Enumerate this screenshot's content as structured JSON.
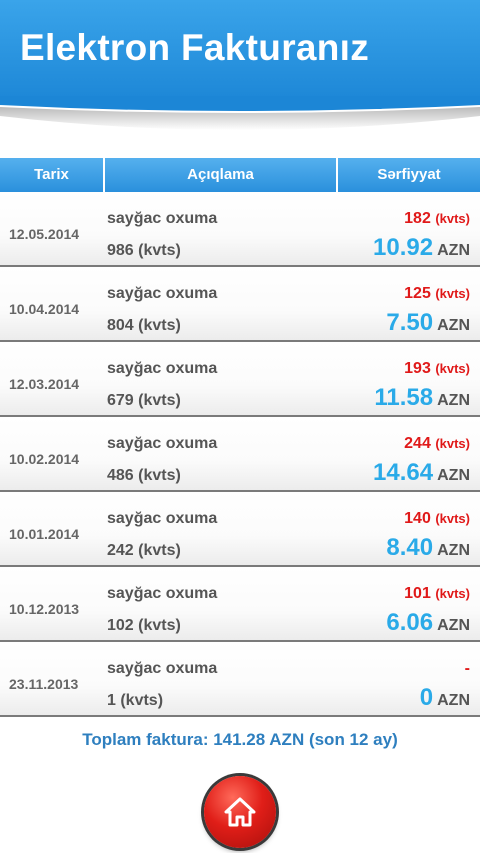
{
  "header": {
    "title": "Elektron Fakturanız"
  },
  "columns": {
    "date": "Tarix",
    "description": "Açıqlama",
    "consumption": "Sərfiyyat"
  },
  "rows": [
    {
      "date": "12.05.2014",
      "desc": "sayğac oxuma",
      "reading": "986 (kvts)",
      "consumption": "182",
      "consumption_unit": "(kvts)",
      "amount": "10.92",
      "currency": "AZN"
    },
    {
      "date": "10.04.2014",
      "desc": "sayğac oxuma",
      "reading": "804 (kvts)",
      "consumption": "125",
      "consumption_unit": "(kvts)",
      "amount": "7.50",
      "currency": "AZN"
    },
    {
      "date": "12.03.2014",
      "desc": "sayğac oxuma",
      "reading": "679 (kvts)",
      "consumption": "193",
      "consumption_unit": "(kvts)",
      "amount": "11.58",
      "currency": "AZN"
    },
    {
      "date": "10.02.2014",
      "desc": "sayğac oxuma",
      "reading": "486 (kvts)",
      "consumption": "244",
      "consumption_unit": "(kvts)",
      "amount": "14.64",
      "currency": "AZN"
    },
    {
      "date": "10.01.2014",
      "desc": "sayğac oxuma",
      "reading": "242 (kvts)",
      "consumption": "140",
      "consumption_unit": "(kvts)",
      "amount": "8.40",
      "currency": "AZN"
    },
    {
      "date": "10.12.2013",
      "desc": "sayğac oxuma",
      "reading": "102 (kvts)",
      "consumption": "101",
      "consumption_unit": "(kvts)",
      "amount": "6.06",
      "currency": "AZN"
    },
    {
      "date": "23.11.2013",
      "desc": "sayğac oxuma",
      "reading": "1 (kvts)",
      "consumption": "-",
      "consumption_unit": "",
      "amount": "0",
      "currency": "AZN"
    }
  ],
  "footer": {
    "total": "Toplam faktura: 141.28 AZN (son 12 ay)"
  },
  "home_button": {
    "icon": "home-icon"
  },
  "colors": {
    "header_blue": "#1c86d6",
    "amount_blue": "#2aaae8",
    "consumption_red": "#e01919",
    "total_blue": "#2e7fbf",
    "button_red": "#e01e18"
  }
}
